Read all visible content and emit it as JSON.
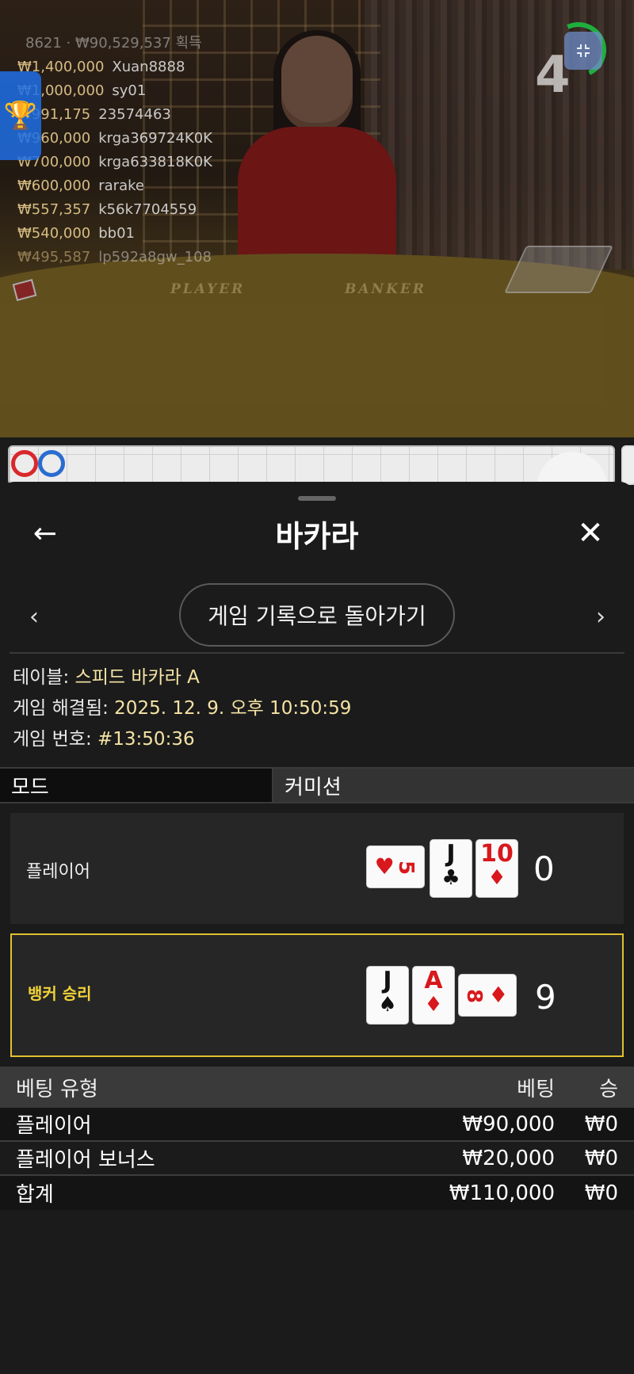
{
  "video": {
    "table_labels": [
      "PLAYER",
      "BANKER"
    ],
    "countdown": "4",
    "recent_winners": [
      {
        "amount": "",
        "name": "8621 · ₩90,529,537 획득"
      },
      {
        "amount": "₩1,400,000",
        "name": "Xuan8888"
      },
      {
        "amount": "₩1,000,000",
        "name": "sy01"
      },
      {
        "amount": "₩991,175",
        "name": "23574463"
      },
      {
        "amount": "₩960,000",
        "name": "krga369724K0K"
      },
      {
        "amount": "₩700,000",
        "name": "krga633818K0K"
      },
      {
        "amount": "₩600,000",
        "name": "rarake"
      },
      {
        "amount": "₩557,357",
        "name": "k56k7704559"
      },
      {
        "amount": "₩540,000",
        "name": "bb01"
      },
      {
        "amount": "₩495,587",
        "name": "lp592a8gw_108"
      }
    ],
    "icons": {
      "leaderboard": "trophy-icon",
      "minimize": "minimize-icon"
    },
    "road_colors": {
      "banker": "#d8282c",
      "player": "#2a6cd0"
    }
  },
  "sheet": {
    "title": "바카라",
    "back_icon": "←",
    "close_icon": "✕",
    "prev_icon": "‹",
    "next_icon": "›",
    "history_button": "게임 기록으로 돌아가기",
    "info": {
      "table_label": "테이블: ",
      "table_value": "스피드 바카라 A",
      "resolved_label": "게임 해결됨: ",
      "resolved_value": "2025. 12. 9. 오후 10:50:59",
      "number_label": "게임 번호: ",
      "number_value": "#13:50:36"
    },
    "mode": {
      "label": "모드",
      "value": "커미션"
    },
    "player": {
      "label": "플레이어",
      "score": "0",
      "cards": [
        {
          "rank": "5",
          "suit": "♥",
          "color": "red",
          "orientation": "side"
        },
        {
          "rank": "J",
          "suit": "♣",
          "color": "black",
          "orientation": "up"
        },
        {
          "rank": "10",
          "suit": "♦",
          "color": "red",
          "orientation": "up"
        }
      ]
    },
    "banker": {
      "label": "뱅커 승리",
      "score": "9",
      "accent": "#e0c030",
      "cards": [
        {
          "rank": "J",
          "suit": "♠",
          "color": "black",
          "orientation": "up"
        },
        {
          "rank": "A",
          "suit": "♦",
          "color": "red",
          "orientation": "up"
        },
        {
          "rank": "8",
          "suit": "♦",
          "color": "red",
          "orientation": "side"
        }
      ]
    },
    "bets": {
      "headers": {
        "type": "베팅 유형",
        "bet": "베팅",
        "win": "승"
      },
      "rows": [
        {
          "type": "플레이어",
          "bet": "₩90,000",
          "win": "₩0"
        },
        {
          "type": "플레이어 보너스",
          "bet": "₩20,000",
          "win": "₩0"
        },
        {
          "type": "합계",
          "bet": "₩110,000",
          "win": "₩0"
        }
      ]
    }
  }
}
